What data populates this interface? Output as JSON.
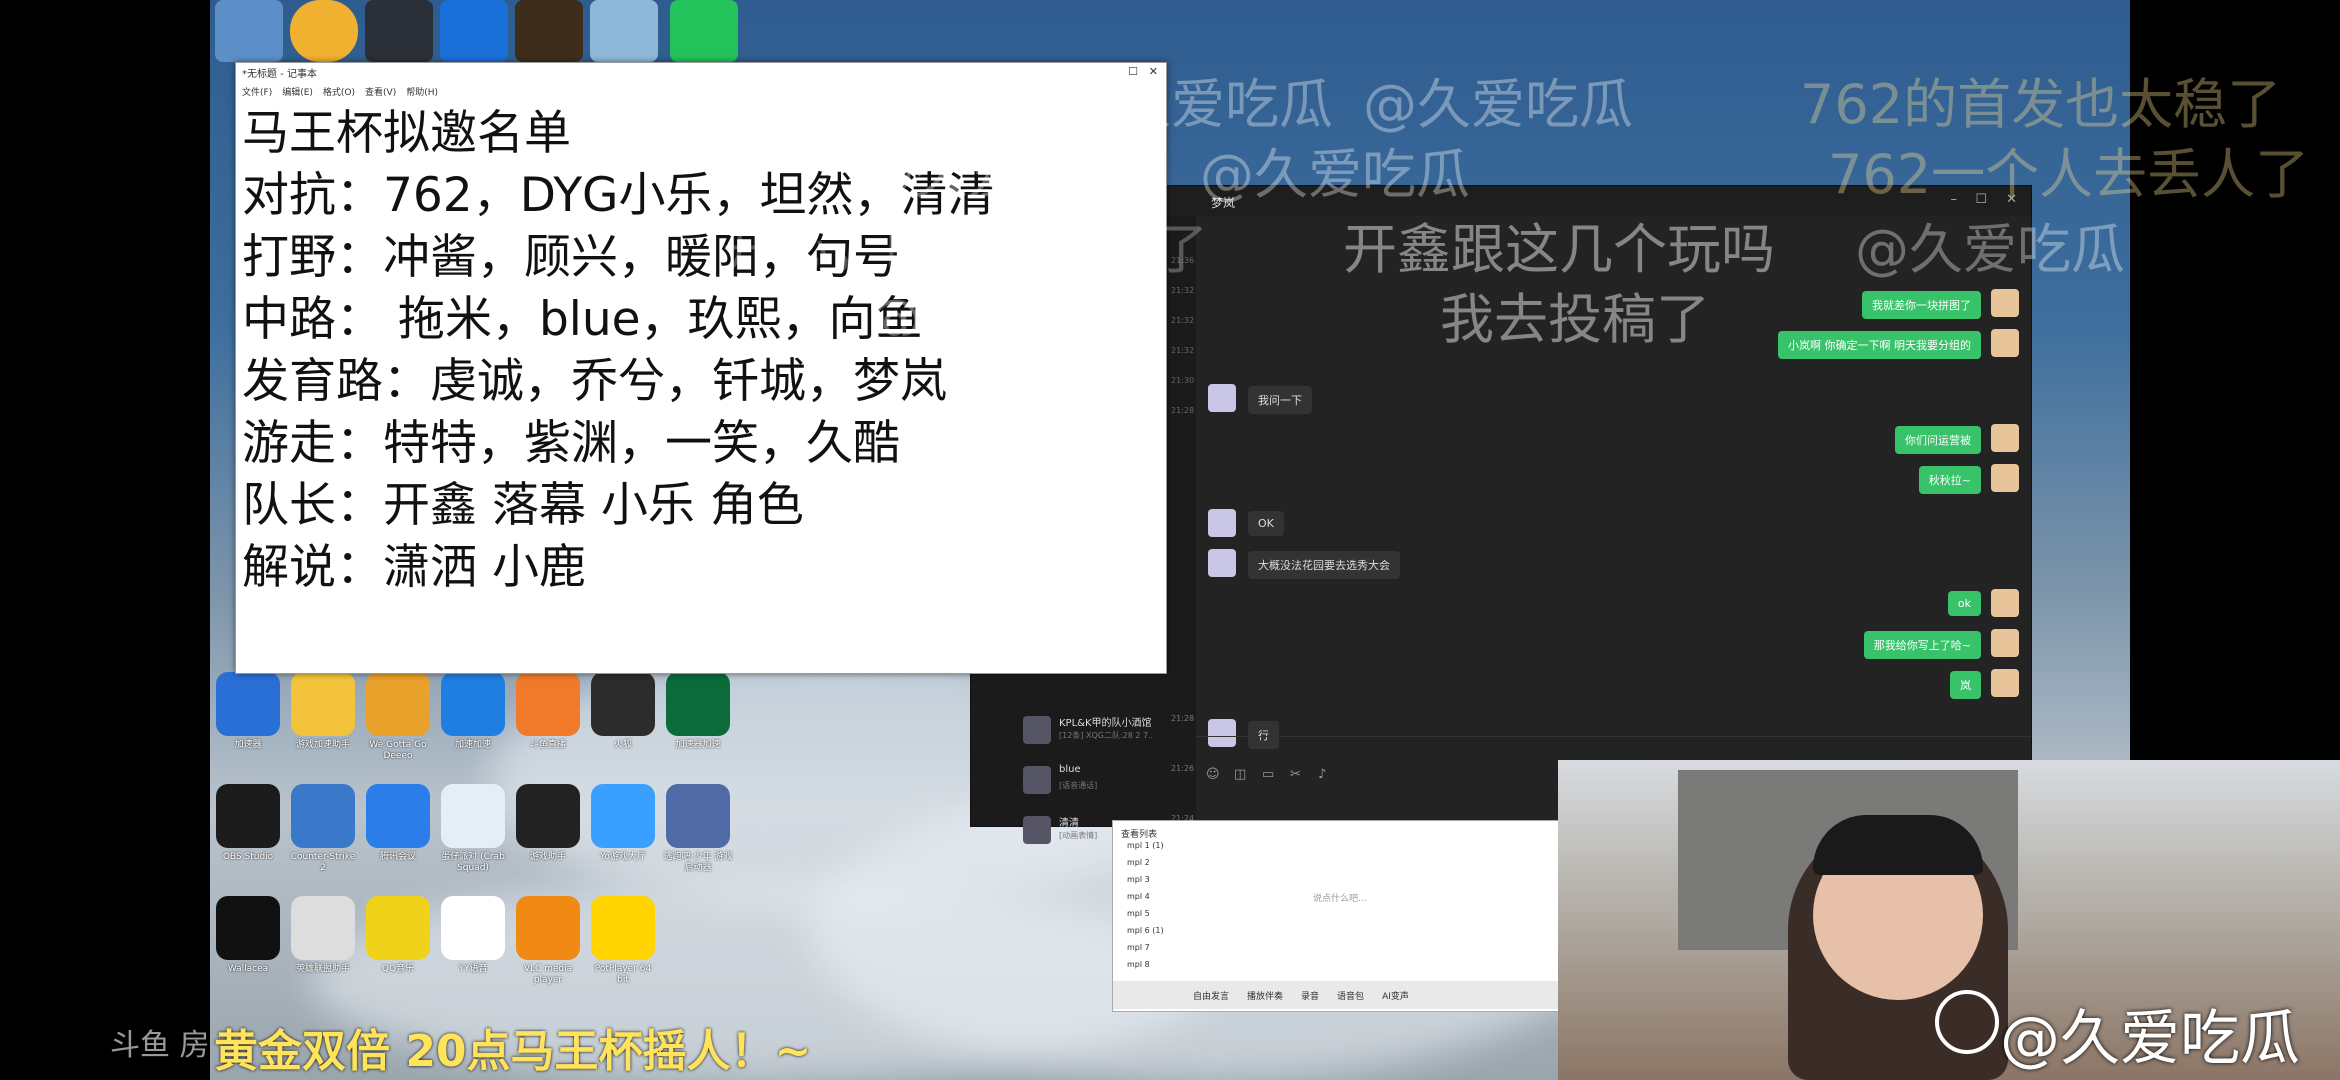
{
  "notepad": {
    "title": "*无标题 - 记事本",
    "menu": [
      "文件(F)",
      "编辑(E)",
      "格式(O)",
      "查看(V)",
      "帮助(H)"
    ],
    "lines": [
      "马王杯拟邀名单",
      "对抗：762，DYG小乐，坦然，清清",
      "打野：冲酱，顾兴，暖阳，句号",
      "中路： 拖米，blue，玖熙，向鱼",
      "发育路：虔诚，乔兮，钎城，梦岚",
      "游走：特特，紫渊，一笑，久酷",
      "队长：开鑫 落幕 小乐 角色",
      "解说：潇洒 小鹿"
    ]
  },
  "chat": {
    "contact_name": "梦岚",
    "messages_right": [
      "我就差你一块拼图了",
      "小岚啊 你确定一下啊 明天我要分组的",
      "你们问运营被",
      "秋秋拉~",
      "ok",
      "那我给你写上了哈~",
      "岚"
    ],
    "messages_left": [
      "我问一下",
      "OK",
      "大概没法花园要去选秀大会",
      "行"
    ],
    "sessions": [
      {
        "name": "KPL&K甲的队小酒馆",
        "preview": "[12条] XQG二队:28 2 7..",
        "time": "21:28"
      },
      {
        "name": "blue",
        "preview": "[语音通话]",
        "time": "21:26"
      },
      {
        "name": "清清",
        "preview": "[动画表情]",
        "time": "21:24"
      }
    ],
    "side_times": [
      "21:36",
      "21:32",
      "21:32",
      "21:32",
      "21:30",
      "21:28"
    ]
  },
  "desktop_icons": [
    {
      "label": "加速器"
    },
    {
      "label": "游戏加速助手"
    },
    {
      "label": "We Gotta Go Deeeo"
    },
    {
      "label": "加速加速"
    },
    {
      "label": "斗鱼直播"
    },
    {
      "label": "火狐"
    },
    {
      "label": "加速器加速"
    },
    {
      "label": "OBS Studio"
    },
    {
      "label": "Counter-Strike 2"
    },
    {
      "label": "腾讯会议"
    },
    {
      "label": "蛋仔派对 (Crab Squad)"
    },
    {
      "label": "游戏助手"
    },
    {
      "label": "Yo游戏大厅"
    },
    {
      "label": "逃跑吧·少年 游戏启动器"
    },
    {
      "label": "Wallacea"
    },
    {
      "label": "英雄联盟助手"
    },
    {
      "label": "QQ音乐"
    },
    {
      "label": "YY语音"
    },
    {
      "label": "VLC media player"
    },
    {
      "label": "PotPlayer 64 bit"
    }
  ],
  "game_window": {
    "list_header": "查看列表",
    "list_items": [
      "mpl 1 (1)",
      "mpl 2",
      "mpl 3",
      "mpl 4",
      "mpl 5",
      "mpl 6 (1)",
      "mpl 7",
      "mpl 8"
    ],
    "input_placeholder": "说点什么吧...",
    "bottom_bar": [
      "自由发言",
      "播放伴奏",
      "录音",
      "语音包",
      "AI变声"
    ]
  },
  "overlay": {
    "watermarks": [
      "@久爱吃瓜",
      "@久爱吃瓜",
      "@久爱吃瓜",
      "@久爱吃瓜",
      "@久爱吃瓜",
      "@久爱吃瓜",
      "@久爱吃瓜"
    ],
    "danmaku": [
      "762的首发也太稳了",
      "762一个人去丢人了",
      "开鑫跟这几个玩吗",
      "我去投稿了",
      "开心，队长度太低了"
    ],
    "room_label": "斗鱼 房",
    "marquee": "黄金双倍 20点马王杯摇人！~",
    "weibo_handle": "@久爱吃瓜"
  },
  "colors": {
    "chat_green": "#38c26a",
    "marquee_yellow": "#ffe35a"
  }
}
